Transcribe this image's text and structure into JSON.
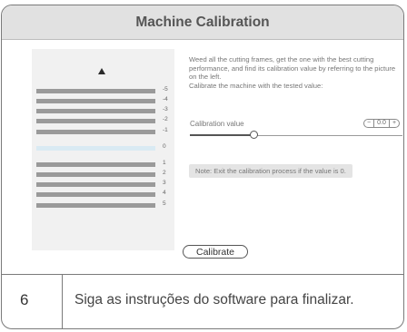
{
  "dialog": {
    "title": "Machine Calibration",
    "description": [
      "Weed all the cutting frames, get the one with the best cutting performance, and find its calibration value by referring to the picture on the left.",
      "Calibrate the machine with the tested value:"
    ],
    "calibration_label": "Calibration value",
    "calibration_value": "0.0",
    "stepper_minus": "−",
    "stepper_plus": "+",
    "slider_level": 0.3,
    "note": "Note: Exit the calibration process if the value is 0.",
    "calibrate_button": "Calibrate",
    "ruler": [
      {
        "label": "-5",
        "highlight": false
      },
      {
        "label": "-4",
        "highlight": false
      },
      {
        "label": "-3",
        "highlight": false
      },
      {
        "label": "-2",
        "highlight": false
      },
      {
        "label": "-1",
        "highlight": false
      },
      {
        "label": "0",
        "highlight": true
      },
      {
        "label": "1",
        "highlight": false
      },
      {
        "label": "2",
        "highlight": false
      },
      {
        "label": "3",
        "highlight": false
      },
      {
        "label": "4",
        "highlight": false
      },
      {
        "label": "5",
        "highlight": false
      }
    ]
  },
  "step": {
    "number": "6",
    "text": "Siga as instruções do software para finalizar."
  },
  "icons": {
    "arrow": "triangle-up-icon"
  }
}
